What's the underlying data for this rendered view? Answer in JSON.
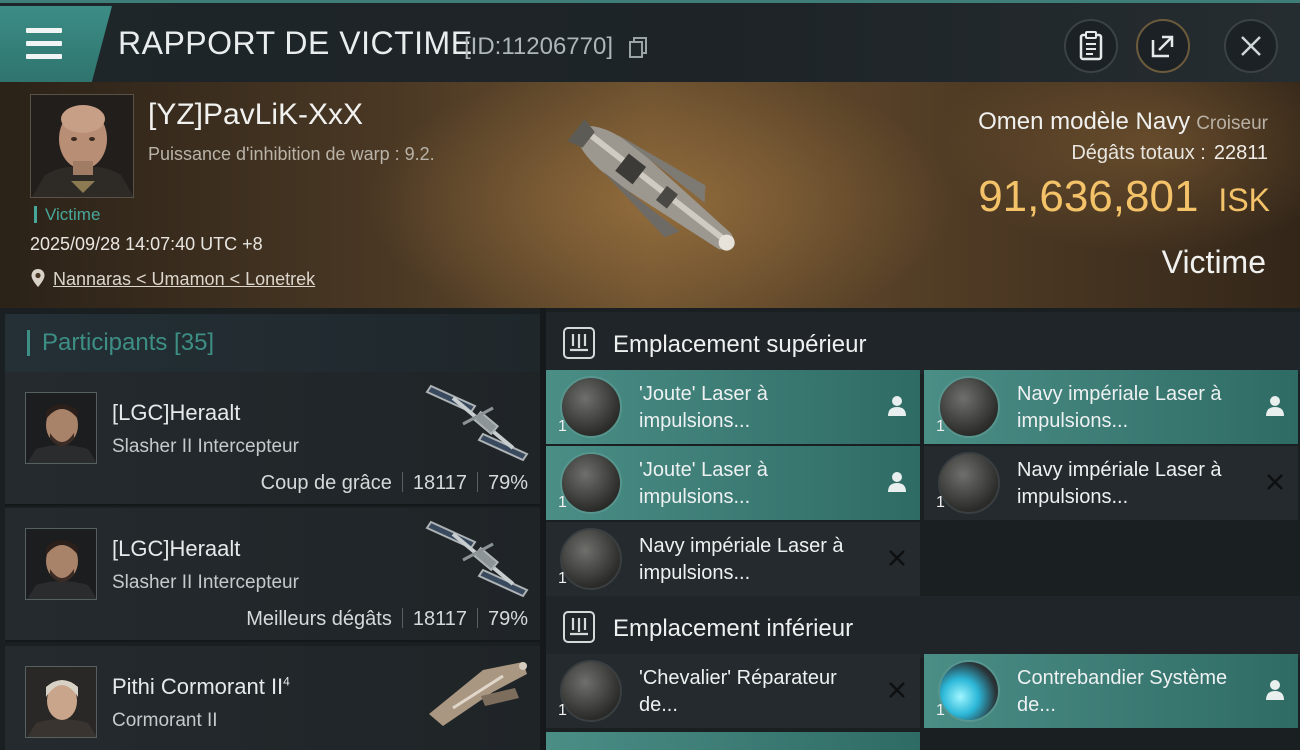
{
  "header": {
    "title": "RAPPORT DE VICTIME",
    "report_id": "[ID:11206770]"
  },
  "victim": {
    "name": "[YZ]PavLiK-XxX",
    "warp_text": "Puissance d'inhibition de warp : 9.2.",
    "badge": "Victime",
    "datetime": "2025/09/28 14:07:40 UTC +8",
    "location": "Nannaras < Umamon < Lonetrek",
    "ship_name": "Omen modèle Navy",
    "ship_class": "Croiseur",
    "damage_label": "Dégâts totaux :",
    "damage_value": "22811",
    "isk_amount": "91,636,801",
    "isk_unit": "ISK",
    "role": "Victime"
  },
  "participants": {
    "title": "Participants [35]",
    "items": [
      {
        "name": "[LGC]Heraalt",
        "name_sup": "",
        "ship": "Slasher II Intercepteur",
        "stat_label": "Coup de grâce",
        "damage": "18117",
        "percent": "79%"
      },
      {
        "name": "[LGC]Heraalt",
        "name_sup": "",
        "ship": "Slasher II Intercepteur",
        "stat_label": "Meilleurs dégâts",
        "damage": "18117",
        "percent": "79%"
      },
      {
        "name": "Pithi Cormorant II",
        "name_sup": "4",
        "ship": "Cormorant II",
        "stat_label": "",
        "damage": "",
        "percent": ""
      }
    ]
  },
  "fittings": {
    "high_slot_title": "Emplacement supérieur",
    "low_slot_title": "Emplacement inférieur",
    "high_modules": [
      {
        "name": "'Joute' Laser à impulsions...",
        "qty": "1",
        "state": "person-icon"
      },
      {
        "name": "Navy impériale Laser à impulsions...",
        "qty": "1",
        "state": "person-icon"
      },
      {
        "name": "'Joute' Laser à impulsions...",
        "qty": "1",
        "state": "person-icon"
      },
      {
        "name": "Navy impériale Laser à impulsions...",
        "qty": "1",
        "state": "destroyed-icon"
      },
      {
        "name": "Navy impériale Laser à impulsions...",
        "qty": "1",
        "state": "destroyed-icon"
      }
    ],
    "low_modules": [
      {
        "name": "'Chevalier' Réparateur de...",
        "qty": "1",
        "state": "destroyed-icon"
      },
      {
        "name": "Contrebandier Système de...",
        "qty": "1",
        "state": "person-icon"
      }
    ]
  },
  "colors": {
    "accent_teal": "#3d8f86",
    "isk_gold": "#f4c268",
    "active_module": "#4a8e86"
  }
}
